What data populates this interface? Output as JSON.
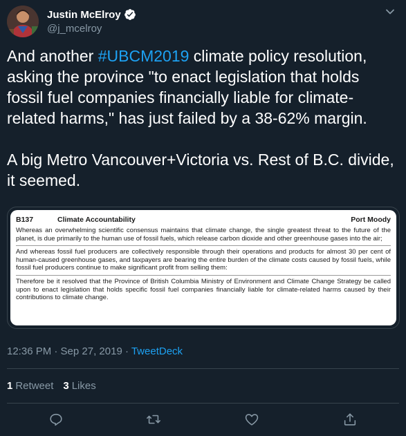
{
  "author": {
    "display_name": "Justin McElroy",
    "handle": "@j_mcelroy"
  },
  "tweet": {
    "line1_pre": "And another ",
    "hashtag": "#UBCM2019",
    "line1_post": " climate policy resolution, asking the province \"to enact legislation that holds fossil fuel companies financially liable for climate-related harms,\" has just failed by a 38-62% margin.",
    "para2": "A big Metro Vancouver+Victoria vs. Rest of B.C. divide, it seemed."
  },
  "document": {
    "code": "B137",
    "title": "Climate Accountability",
    "sponsor": "Port Moody",
    "paragraphs": [
      "Whereas an overwhelming scientific consensus maintains that climate change, the single greatest threat to the future of the planet, is due primarily to the human use of fossil fuels, which release carbon dioxide and other greenhouse gases into the air;",
      "And whereas fossil fuel producers are collectively responsible through their operations and products for almost 30 per cent of human-caused greenhouse gases, and taxpayers are bearing the entire burden of the climate costs caused by fossil fuels, while fossil fuel producers continue to make significant profit from selling them:",
      "Therefore be it resolved that the Province of British Columbia Ministry of Environment and Climate Change Strategy be called upon to enact legislation that holds specific fossil fuel companies financially liable for climate-related harms caused by their contributions to climate change."
    ]
  },
  "meta": {
    "timestamp": "12:36 PM · Sep 27, 2019 · ",
    "source": "TweetDeck"
  },
  "stats": {
    "retweets_count": "1",
    "retweets_label": "Retweet",
    "likes_count": "3",
    "likes_label": "Likes"
  },
  "icons": {
    "accent": "#1da1f2",
    "muted": "#8899a6",
    "background": "#15202b"
  }
}
